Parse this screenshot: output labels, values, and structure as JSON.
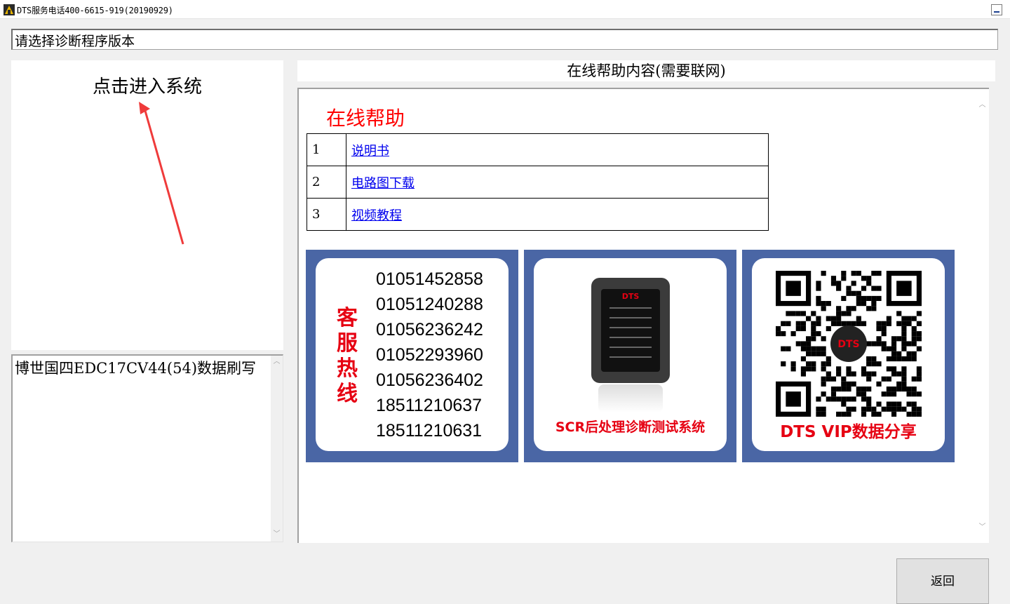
{
  "window": {
    "title": "DTS服务电话400-6615-919(20190929)"
  },
  "version_field": {
    "value": "请选择诊断程序版本"
  },
  "enter_panel": {
    "label": "点击进入系统"
  },
  "description": {
    "text": "博世国四EDC17CV44(54)数据刷写"
  },
  "help": {
    "header": "在线帮助内容(需要联网)",
    "title": "在线帮助",
    "rows": [
      {
        "num": "1",
        "label": "说明书"
      },
      {
        "num": "2",
        "label": "电路图下载"
      },
      {
        "num": "3",
        "label": "视频教程"
      }
    ]
  },
  "banners": {
    "hotline": {
      "title": "客服热线",
      "phones": [
        "01051452858",
        "01051240288",
        "01056236242",
        "01052293960",
        "01056236402",
        "18511210637",
        "18511210631"
      ]
    },
    "device": {
      "logo": "DTS",
      "caption": "SCR后处理诊断测试系统"
    },
    "vip": {
      "qr_logo": "DTS",
      "caption": "DTS VIP数据分享"
    }
  },
  "buttons": {
    "back": "返回"
  },
  "colors": {
    "accent_red": "#e60012",
    "banner_blue": "#4a66a5",
    "link_blue": "#0000ee"
  }
}
